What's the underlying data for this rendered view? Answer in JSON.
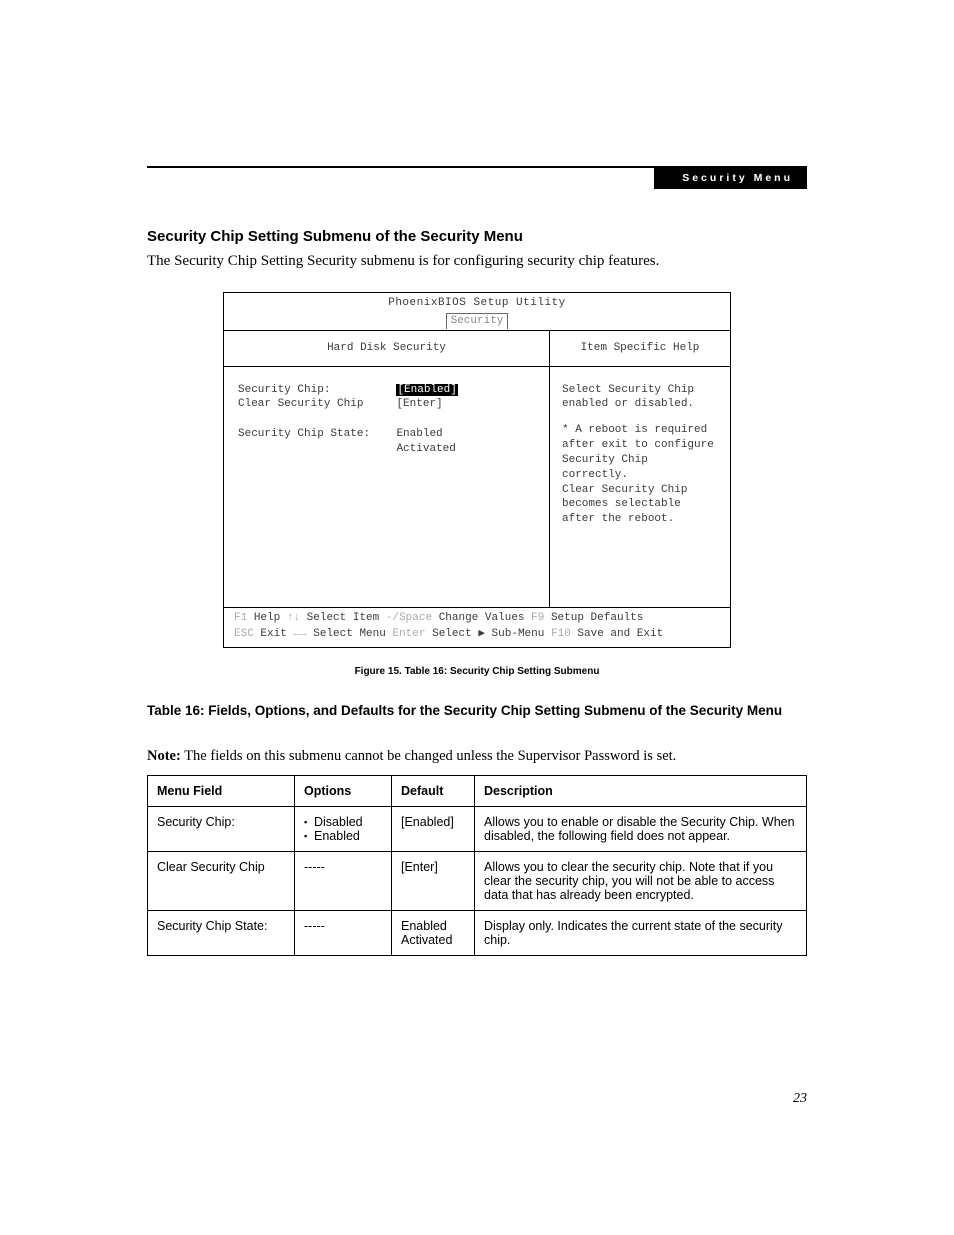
{
  "header_badge": "Security Menu",
  "section_title": "Security Chip Setting Submenu of the Security Menu",
  "intro": "The Security Chip Setting Security submenu is for configuring security chip features.",
  "bios": {
    "utility_title": "PhoenixBIOS Setup Utility",
    "tab": "Security",
    "left_pane_title": "Hard Disk Security",
    "right_pane_title": "Item Specific Help",
    "fields": {
      "security_chip_label": "Security Chip:",
      "security_chip_value": "[Enabled]",
      "clear_label": "Clear Security Chip",
      "clear_value": "[Enter]",
      "state_label": "Security Chip State:",
      "state_value1": "Enabled",
      "state_value2": "Activated"
    },
    "help_line1": "Select Security Chip",
    "help_line2": "enabled or disabled.",
    "help_line3": "* A reboot is required",
    "help_line4": "after exit to configure",
    "help_line5": "Security Chip correctly.",
    "help_line6": "Clear Security Chip",
    "help_line7": "becomes selectable",
    "help_line8": "after the reboot.",
    "footer": {
      "f1": "F1",
      "help": "Help",
      "updown": "↑↓",
      "select_item": "Select Item",
      "minus_space": "-/Space",
      "change_values": "Change Values",
      "f9": "F9",
      "setup_defaults": "Setup Defaults",
      "esc": "ESC",
      "exit": "Exit",
      "leftright": "←→",
      "select_menu": "Select Menu",
      "enter": "Enter",
      "select_sub": "Select ▶ Sub-Menu",
      "f10": "F10",
      "save_exit": "Save and Exit"
    }
  },
  "figure_caption": "Figure 15.  Table 16: Security Chip Setting Submenu",
  "table_title": "Table 16: Fields, Options, and Defaults for the Security Chip Setting Submenu of the Security Menu",
  "note_label": "Note:",
  "note_text": " The fields on this submenu cannot be changed unless the Supervisor Password is set.",
  "table": {
    "headers": {
      "menu": "Menu Field",
      "options": "Options",
      "default": "Default",
      "description": "Description"
    },
    "rows": [
      {
        "menu": "Security Chip:",
        "options": [
          "Disabled",
          "Enabled"
        ],
        "default": "[Enabled]",
        "description": "Allows you to enable or disable the Security Chip. When disabled, the following field does not appear."
      },
      {
        "menu": "Clear Security Chip",
        "options": "-----",
        "default": "[Enter]",
        "description": "Allows you to clear the security chip. Note that if you clear the security chip, you will not be able to access data that has already been encrypted."
      },
      {
        "menu": "Security Chip State:",
        "options": "-----",
        "default": "Enabled Activated",
        "description": "Display only. Indicates the current state of the security chip."
      }
    ]
  },
  "page_number": "23"
}
